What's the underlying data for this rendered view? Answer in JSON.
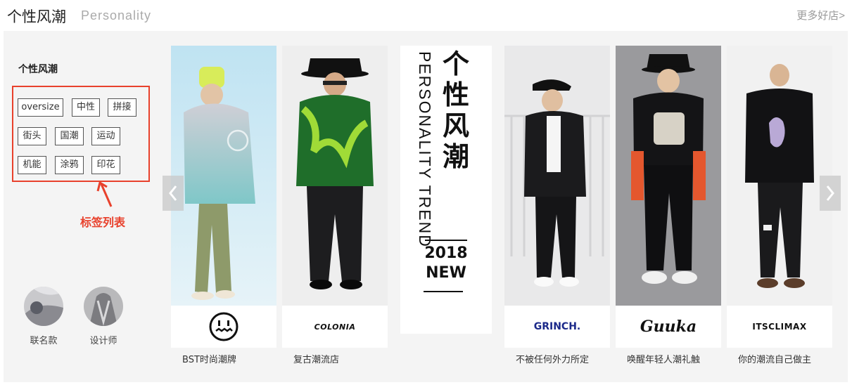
{
  "header": {
    "title_cn": "个性风潮",
    "title_en": "Personality",
    "more_label": "更多好店>"
  },
  "sidebar": {
    "title": "个性风潮",
    "tags": [
      "oversize",
      "中性",
      "拼接",
      "街头",
      "国潮",
      "运动",
      "机能",
      "涂鸦",
      "印花"
    ],
    "annotation": "标签列表",
    "circles": [
      {
        "label": "联名款"
      },
      {
        "label": "设计师"
      }
    ]
  },
  "promo": {
    "title_cn": "个性风潮",
    "text_en": "PERSONALITY TREND",
    "year": "2018",
    "word": "NEW"
  },
  "cards": [
    {
      "brand": "",
      "caption": "BST时尚潮牌"
    },
    {
      "brand": "COLONIA",
      "caption": "复古潮流店"
    },
    {
      "brand": "GRINCH.",
      "caption": "不被任何外力所定"
    },
    {
      "brand": "Guuka",
      "caption": "唤醒年轻人潮礼触"
    },
    {
      "brand": "ITSCLIMAX",
      "caption": "你的潮流自己做主"
    }
  ],
  "colors": {
    "accent": "#e8412c",
    "panel": "#f4f4f4"
  }
}
